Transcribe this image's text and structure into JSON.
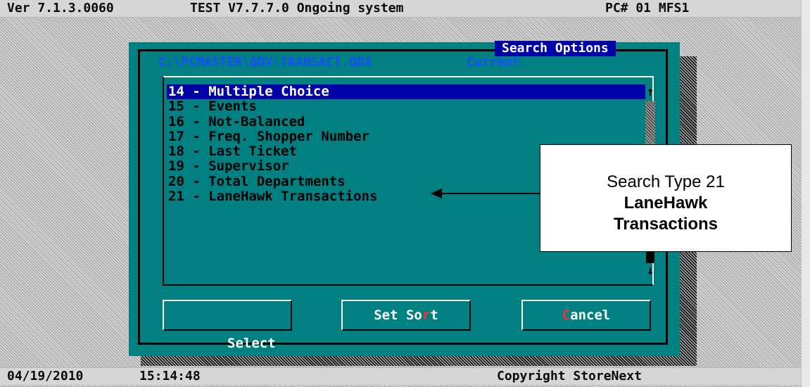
{
  "topbar": {
    "version": "Ver 7.1.3.0060",
    "system": "TEST V7.7.7.0 Ongoing system",
    "pc": "PC# 01 MFS1"
  },
  "dialog": {
    "title": "Search Options",
    "path": "C:\\PCMASTER\\QDX\\TRANSACT.QDX",
    "status": "Current",
    "items": [
      "14 - Multiple Choice",
      "15 - Events",
      "16 - Not-Balanced",
      "17 - Freq. Shopper Number",
      "18 - Last Ticket",
      "19 - Supervisor",
      "20 - Total Departments",
      "21 - LaneHawk Transactions"
    ],
    "selected_index": 0,
    "buttons": {
      "select": "Select",
      "set_sort_pre": "Set So",
      "set_sort_hot": "r",
      "set_sort_post": "t",
      "cancel_hot": "C",
      "cancel_post": "ancel"
    }
  },
  "callout": {
    "line1": "Search Type 21",
    "line2": "LaneHawk",
    "line3": "Transactions"
  },
  "bottombar": {
    "date": "04/19/2010",
    "time": "15:14:48",
    "copyright": "Copyright StoreNext"
  },
  "colors": {
    "dialog_bg": "#008080",
    "selection": "#0000a8",
    "path_text": "#1a4dff",
    "hotkey": "#ff3030"
  },
  "icons": {
    "scroll_up": "up-arrow-icon",
    "scroll_down": "down-arrow-icon",
    "pointer": "left-arrow-icon"
  }
}
